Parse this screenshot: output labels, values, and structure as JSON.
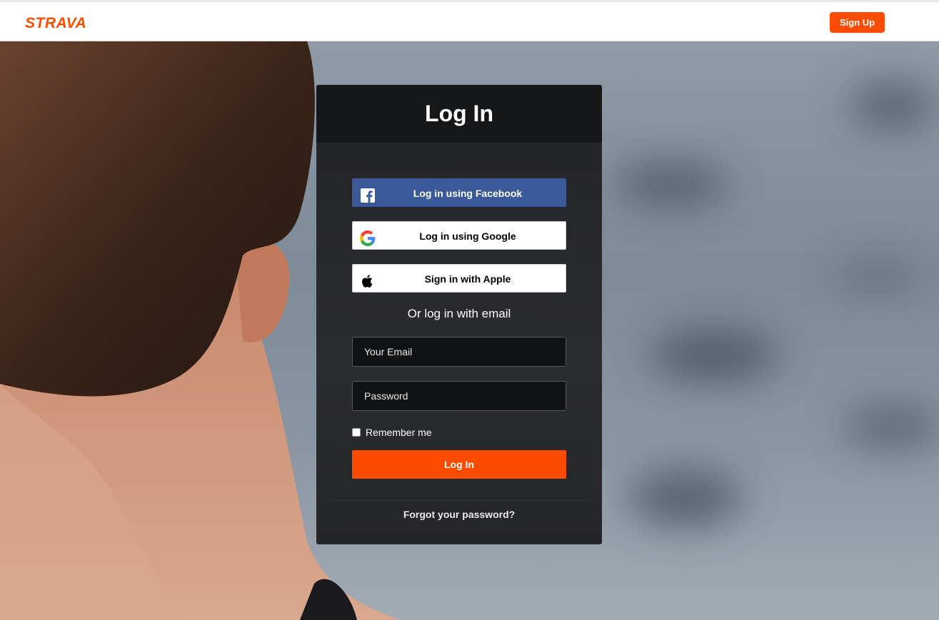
{
  "header": {
    "logo_text": "STRAVA",
    "signup_label": "Sign Up",
    "brand_color": "#fc4c02"
  },
  "login": {
    "title": "Log In",
    "facebook_label": "Log in using Facebook",
    "google_label": "Log in using Google",
    "apple_label": "Sign in with Apple",
    "or_email_text": "Or log in with email",
    "email_placeholder": "Your Email",
    "email_value": "",
    "password_placeholder": "Password",
    "password_value": "",
    "remember_label": "Remember me",
    "remember_checked": false,
    "submit_label": "Log In",
    "forgot_label": "Forgot your password?"
  },
  "icons": {
    "facebook": "facebook-icon",
    "google": "google-icon",
    "apple": "apple-icon"
  },
  "colors": {
    "facebook": "#3b5998",
    "card_header": "#161719",
    "card_body": "#28292d"
  }
}
